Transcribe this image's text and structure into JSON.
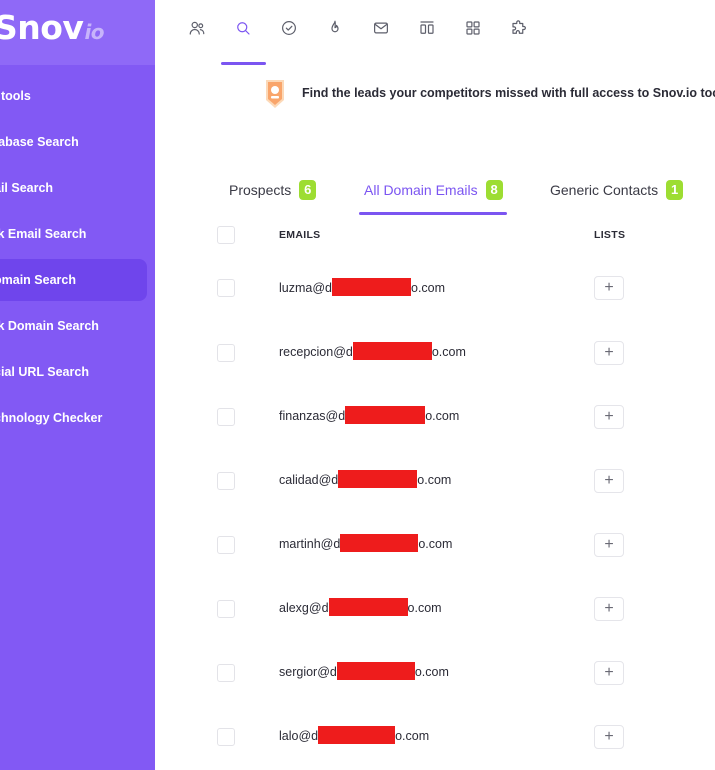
{
  "app": {
    "logo": "Snov",
    "logo_suffix": "io"
  },
  "sidebar": {
    "items": [
      {
        "label": "l tools",
        "active": false
      },
      {
        "label": "tabase Search",
        "active": false
      },
      {
        "label": "ail Search",
        "active": false
      },
      {
        "label": "lk Email Search",
        "active": false
      },
      {
        "label": "omain Search",
        "active": true
      },
      {
        "label": "lk Domain Search",
        "active": false
      },
      {
        "label": "cial URL Search",
        "active": false
      },
      {
        "label": "chnology Checker",
        "active": false
      }
    ]
  },
  "topbar": {
    "icons": [
      "users-icon",
      "search-icon",
      "check-circle-icon",
      "flame-icon",
      "mail-icon",
      "columns-icon",
      "grid-icon",
      "puzzle-icon"
    ],
    "active_icon": "search-icon"
  },
  "banner": {
    "text": "Find the leads your competitors missed with full access to Snov.io tools"
  },
  "tabs": [
    {
      "label": "Prospects",
      "count": "6"
    },
    {
      "label": "All Domain Emails",
      "count": "8",
      "active": true
    },
    {
      "label": "Generic Contacts",
      "count": "1"
    }
  ],
  "table": {
    "headers": {
      "emails": "EMAILS",
      "lists": "LISTS"
    },
    "rows": [
      {
        "prefix": "luzma@d",
        "suffix": "o.com"
      },
      {
        "prefix": "recepcion@d",
        "suffix": "o.com"
      },
      {
        "prefix": "finanzas@d",
        "suffix": "o.com"
      },
      {
        "prefix": "calidad@d",
        "suffix": "o.com"
      },
      {
        "prefix": "martinh@d",
        "suffix": "o.com"
      },
      {
        "prefix": "alexg@d",
        "suffix": "o.com"
      },
      {
        "prefix": "sergior@d",
        "suffix": "o.com"
      },
      {
        "prefix": "lalo@d",
        "suffix": "o.com"
      }
    ],
    "add_label": "+"
  },
  "colors": {
    "sidebar": "#8259f4",
    "accent": "#7b55f1",
    "badge": "#9ddd32",
    "redaction": "#ee1c1c"
  }
}
